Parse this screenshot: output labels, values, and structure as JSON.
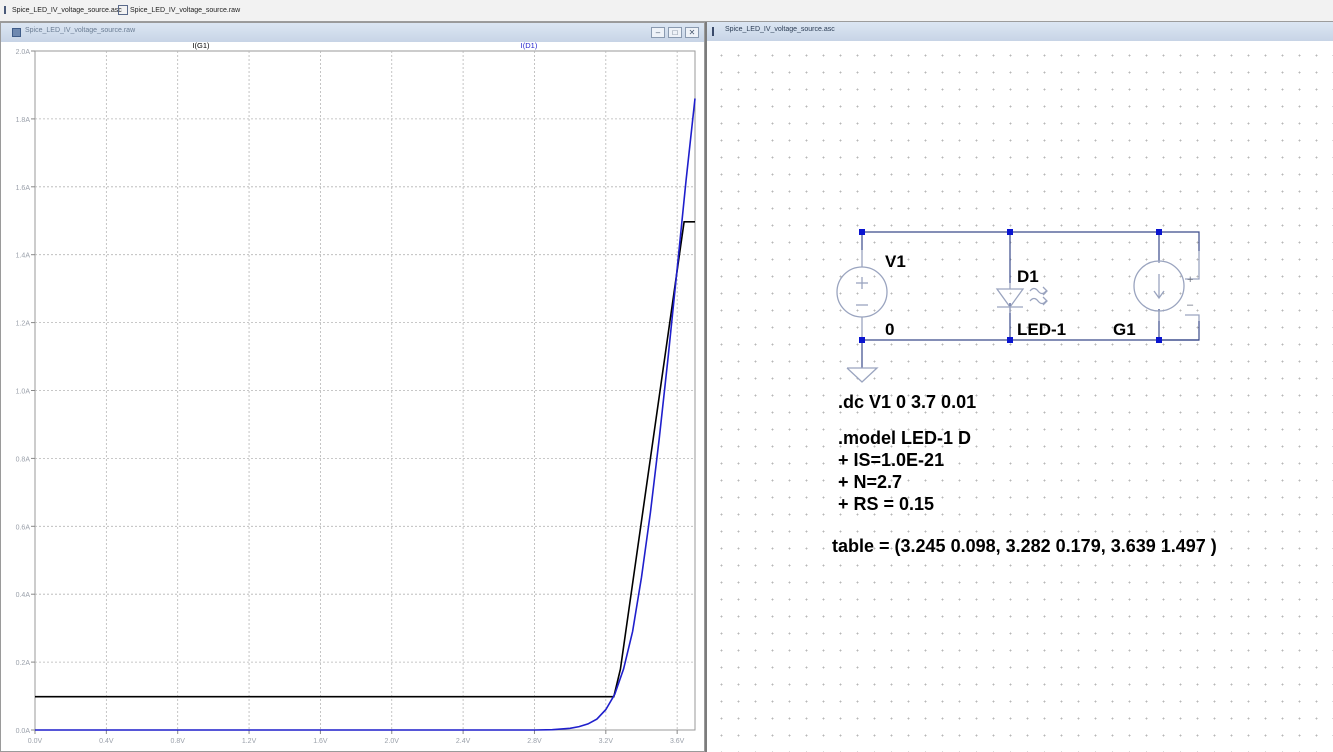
{
  "doc_tabs": [
    {
      "label": "Spice_LED_IV_voltage_source.asc"
    },
    {
      "label": "Spice_LED_IV_voltage_source.raw"
    }
  ],
  "plot_window": {
    "title": "Spice_LED_IV_voltage_source.raw",
    "buttons": [
      "–",
      "□",
      "✕"
    ]
  },
  "chart_data": {
    "type": "line",
    "title": "",
    "xlabel": "",
    "ylabel": "",
    "xlim": [
      0,
      3.7
    ],
    "ylim": [
      0,
      2.0
    ],
    "grid": true,
    "x_ticks": [
      "0.0V",
      "0.4V",
      "0.8V",
      "1.2V",
      "1.6V",
      "2.0V",
      "2.4V",
      "2.8V",
      "3.2V",
      "3.6V"
    ],
    "y_ticks": [
      "0.0A",
      "0.2A",
      "0.4A",
      "0.6A",
      "0.8A",
      "1.0A",
      "1.2A",
      "1.4A",
      "1.6A",
      "1.8A",
      "2.0A"
    ],
    "series": [
      {
        "name": "I(G1)",
        "color": "#000000",
        "x": [
          0,
          3.245,
          3.282,
          3.639,
          3.7
        ],
        "y": [
          0.098,
          0.098,
          0.179,
          1.497,
          1.497
        ]
      },
      {
        "name": "I(D1)",
        "color": "#1f1fcc",
        "x": [
          0,
          2.8,
          2.9,
          3.0,
          3.05,
          3.1,
          3.15,
          3.2,
          3.25,
          3.3,
          3.35,
          3.4,
          3.45,
          3.5,
          3.55,
          3.6,
          3.65,
          3.7
        ],
        "y": [
          0,
          0,
          0.001,
          0.005,
          0.01,
          0.018,
          0.032,
          0.06,
          0.105,
          0.18,
          0.29,
          0.45,
          0.64,
          0.86,
          1.1,
          1.36,
          1.62,
          1.86
        ]
      }
    ]
  },
  "schematic_window": {
    "title": "Spice_LED_IV_voltage_source.asc"
  },
  "schematic": {
    "v1_label": "V1",
    "node_label": "0",
    "d1_label": "D1",
    "d1_model": "LED-1",
    "g1_label": "G1",
    "plus": "+",
    "minus": "–",
    "wire_color": "#3a4a8a",
    "component_color": "#9aa4bf",
    "junction_color": "#0a14d0"
  },
  "directives": {
    "dc": ".dc V1 0 3.7 0.01",
    "model_lines": [
      ".model LED-1 D",
      "+ IS=1.0E-21",
      "+ N=2.7",
      "+ RS = 0.15"
    ],
    "table": "table = (3.245 0.098, 3.282 0.179, 3.639 1.497  )"
  }
}
